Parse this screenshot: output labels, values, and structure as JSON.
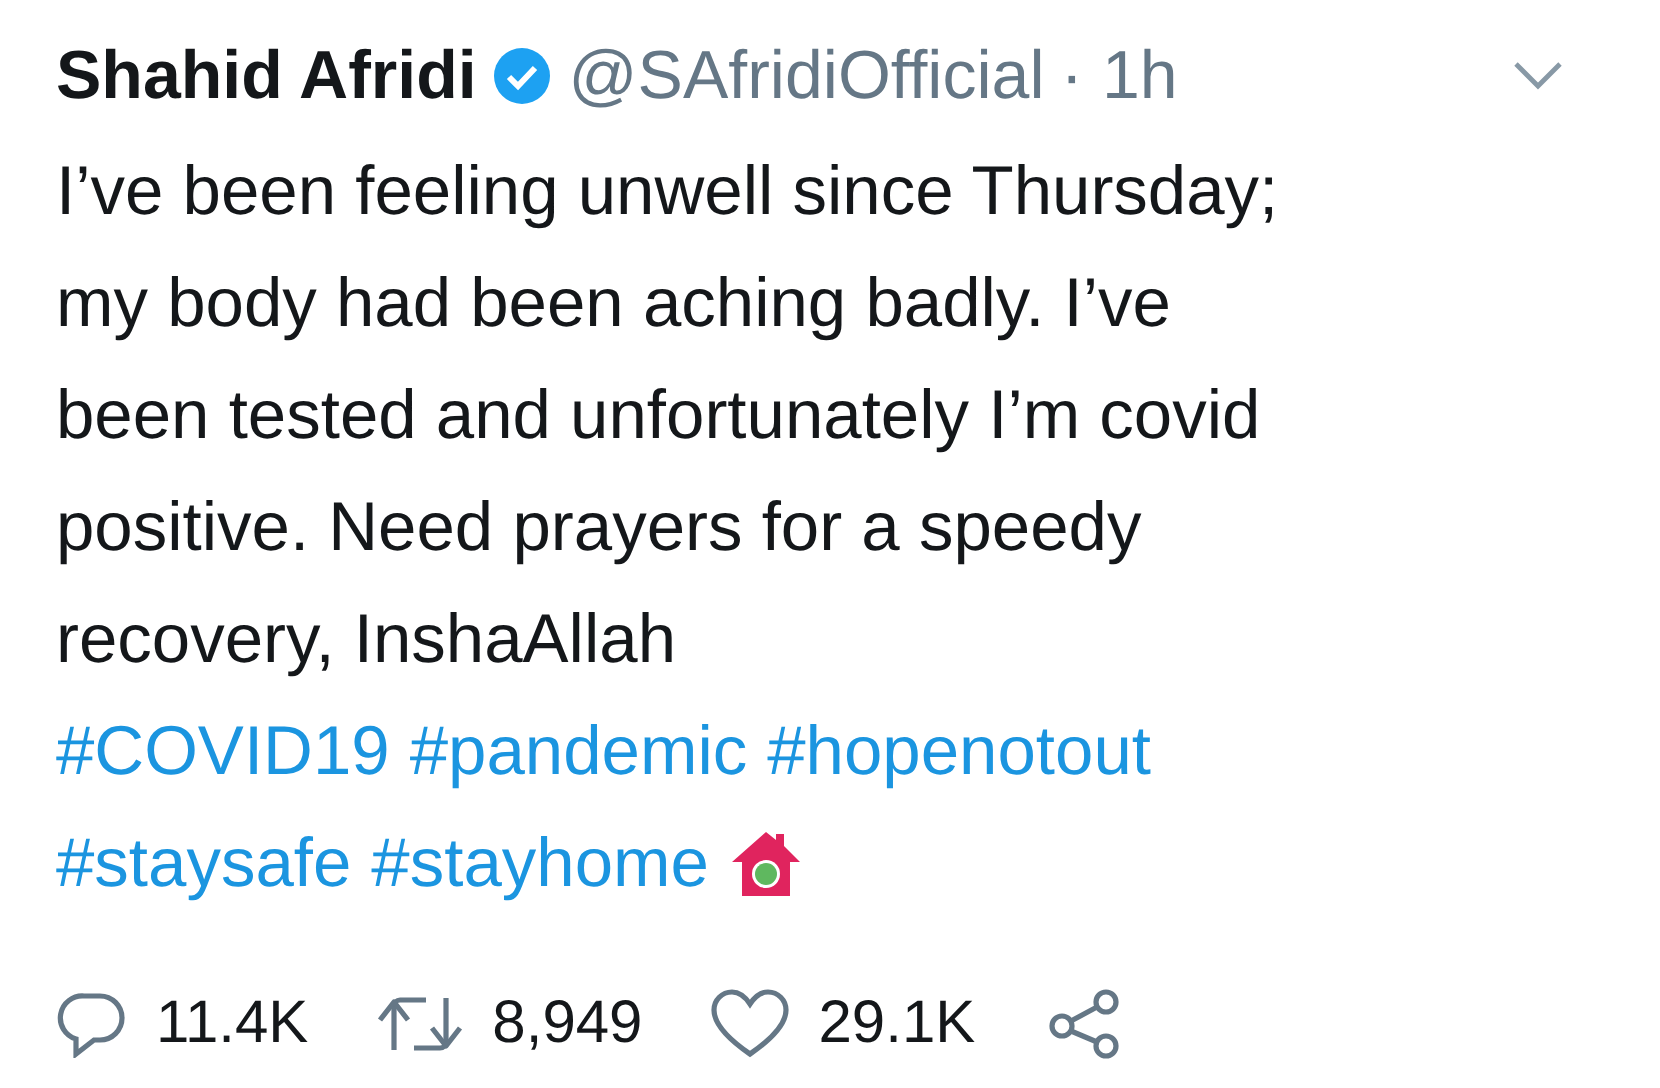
{
  "tweet": {
    "author": {
      "name": "Shahid Afridi",
      "verified": true,
      "handle": "@SAfridiOfficial",
      "time": "· 1h"
    },
    "text": "I’ve been feeling unwell since Thursday;\nmy body had been aching badly. I’ve\nbeen tested and unfortunately I’m covid\npositive. Need prayers for a speedy\nrecovery, InshaAllah",
    "hashtag_lines": [
      [
        "#COVID19",
        "#pandemic",
        "#hopenotout"
      ],
      [
        "#staysafe",
        "#stayhome"
      ]
    ],
    "actions": [
      {
        "kind": "reply",
        "count": "11.4K"
      },
      {
        "kind": "retweet",
        "count": "8,949"
      },
      {
        "kind": "like",
        "count": "29.1K"
      },
      {
        "kind": "share"
      }
    ]
  }
}
